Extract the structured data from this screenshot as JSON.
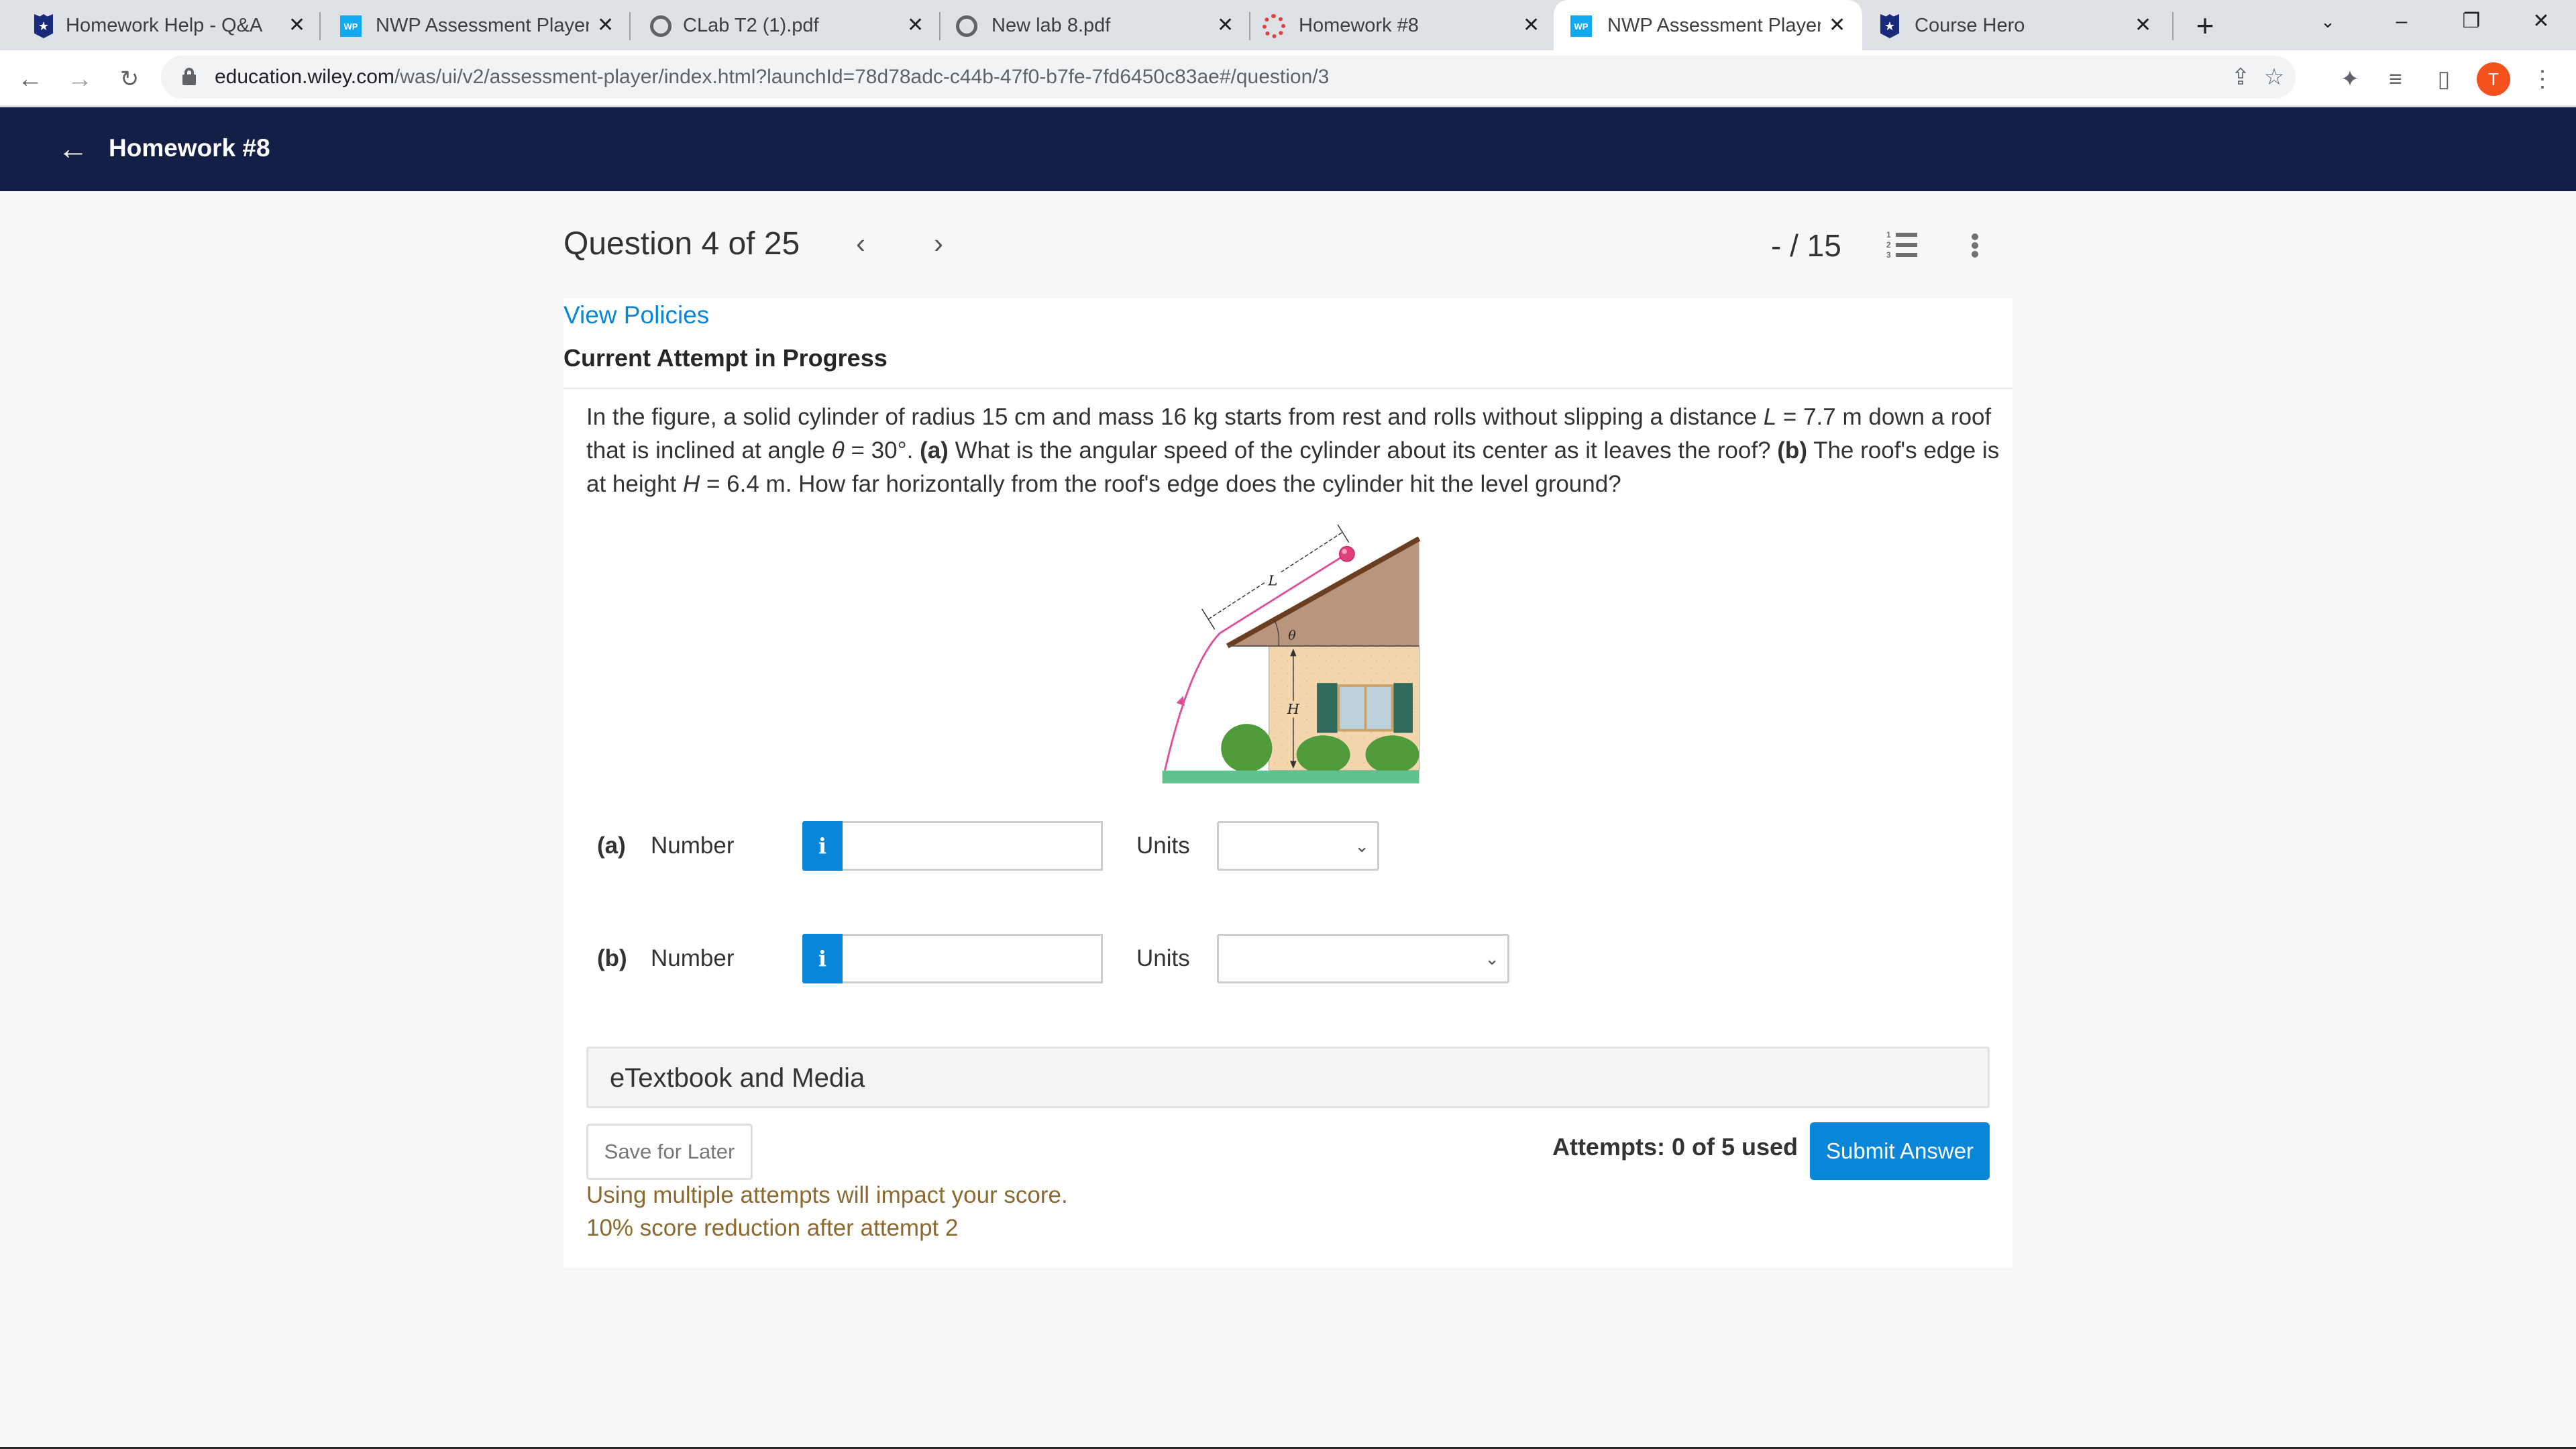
{
  "browser": {
    "tabs": [
      {
        "title": "Homework Help - Q&A fro",
        "favicon": "course-hero-icon",
        "active": false
      },
      {
        "title": "NWP Assessment Player U",
        "favicon": "wp-icon",
        "active": false
      },
      {
        "title": "CLab T2 (1).pdf",
        "favicon": "globe-icon",
        "active": false
      },
      {
        "title": "New lab 8.pdf",
        "favicon": "globe-icon",
        "active": false
      },
      {
        "title": "Homework #8",
        "favicon": "canvas-icon",
        "active": false
      },
      {
        "title": "NWP Assessment Player U",
        "favicon": "wp-icon",
        "active": true
      },
      {
        "title": "Course Hero",
        "favicon": "course-hero-icon",
        "active": false
      }
    ],
    "close_glyph": "✕",
    "new_tab_glyph": "+",
    "url_domain": "education.wiley.com",
    "url_path": "/was/ui/v2/assessment-player/index.html?launchId=78d78adc-c44b-47f0-b7fe-7fd6450c83ae#/question/3",
    "profile_initial": "T"
  },
  "app": {
    "header_title": "Homework #8"
  },
  "question": {
    "title": "Question 4 of 25",
    "score": "- / 15",
    "view_policies": "View Policies",
    "status": "Current Attempt in Progress",
    "text_parts": {
      "p1": "In the figure, a solid cylinder of radius 15 cm and mass 16 kg starts from rest and rolls without slipping a distance ",
      "L": "L",
      "p2": " = 7.7 m down a roof that is inclined at angle ",
      "theta": "θ",
      "p3": " = 30°. ",
      "a": "(a)",
      "p4": " What is the angular speed of the cylinder about its center as it leaves the roof? ",
      "b": "(b)",
      "p5": " The roof's edge is at height ",
      "H": "H",
      "p6": " = 6.4 m. How far horizontally from the roof's edge does the cylinder hit the level ground?"
    },
    "figure_labels": {
      "L": "L",
      "theta": "θ",
      "H": "H"
    }
  },
  "answers": [
    {
      "part": "(a)",
      "number_label": "Number",
      "info": "i",
      "value": "",
      "units_label": "Units",
      "units_value": ""
    },
    {
      "part": "(b)",
      "number_label": "Number",
      "info": "i",
      "value": "",
      "units_label": "Units",
      "units_value": ""
    }
  ],
  "etextbook": "eTextbook and Media",
  "footer": {
    "save_later": "Save for Later",
    "attempts": "Attempts: 0 of 5 used",
    "submit": "Submit Answer",
    "warning_1": "Using multiple attempts will impact your score.",
    "warning_2": "10% score reduction after attempt 2"
  },
  "colors": {
    "header_bg": "#141f47",
    "accent_blue": "#0a86d8",
    "warning_text": "#8a6a30",
    "profile_orange": "#f4511e"
  }
}
